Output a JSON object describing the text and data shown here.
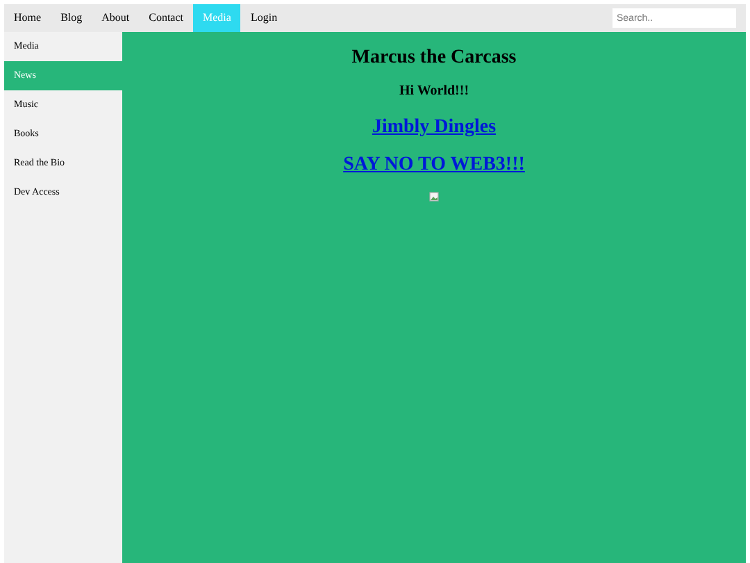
{
  "topnav": {
    "items": [
      {
        "label": "Home",
        "selected": false
      },
      {
        "label": "Blog",
        "selected": false
      },
      {
        "label": "About",
        "selected": false
      },
      {
        "label": "Contact",
        "selected": false
      },
      {
        "label": "Media",
        "selected": true
      },
      {
        "label": "Login",
        "selected": false
      }
    ],
    "search": {
      "placeholder": "Search.."
    }
  },
  "sidebar": {
    "items": [
      {
        "label": "Media",
        "selected": false
      },
      {
        "label": "News",
        "selected": true
      },
      {
        "label": "Music",
        "selected": false
      },
      {
        "label": "Books",
        "selected": false
      },
      {
        "label": "Read the Bio",
        "selected": false
      },
      {
        "label": "Dev Access",
        "selected": false
      }
    ]
  },
  "main": {
    "title": "Marcus the Carcass",
    "subtitle": "Hi World!!!",
    "links": [
      "Jimbly Dingles",
      "SAY NO TO WEB3!!!"
    ],
    "image": {
      "kind": "broken-image"
    }
  }
}
